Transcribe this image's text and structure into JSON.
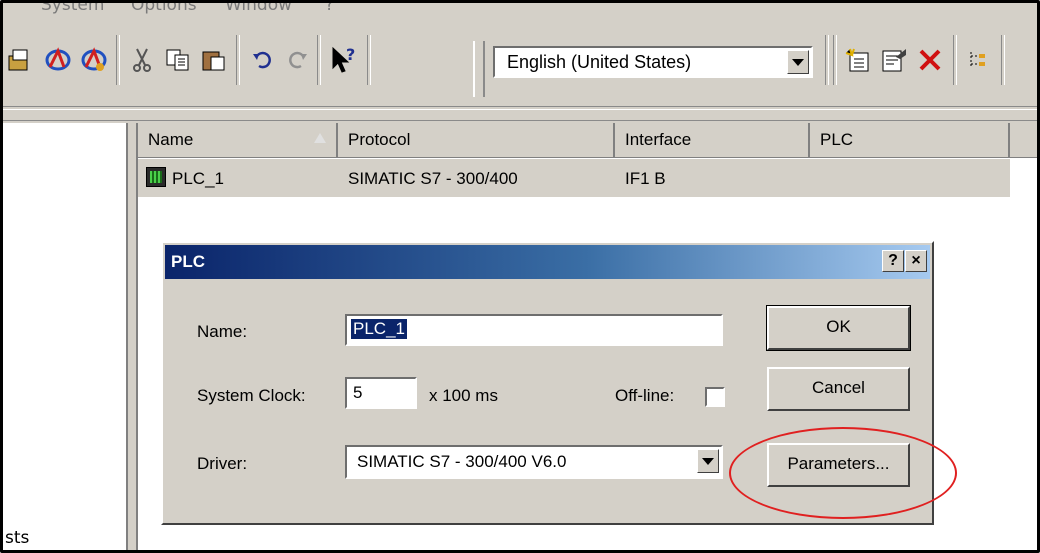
{
  "menu": {
    "items": [
      "System",
      "Options",
      "Window",
      "?"
    ]
  },
  "toolbar": {
    "icons": [
      "open-icon",
      "network-icon",
      "network-connect-icon",
      "cut-icon",
      "copy-icon",
      "paste-icon",
      "undo-icon",
      "redo-icon",
      "help-cursor-icon",
      "new-icon",
      "properties-icon",
      "delete-icon",
      "tree-icon"
    ],
    "language": "English (United States)"
  },
  "left_pane": {
    "item": "sts"
  },
  "list": {
    "columns": [
      "Name",
      "Protocol",
      "Interface",
      "PLC"
    ],
    "rows": [
      {
        "name": "PLC_1",
        "protocol": "SIMATIC S7 - 300/400",
        "interface": "IF1 B",
        "plc": ""
      }
    ]
  },
  "dialog": {
    "title": "PLC",
    "help_label": "?",
    "close_label": "×",
    "name_label": "Name:",
    "name_value": "PLC_1",
    "clock_label": "System Clock:",
    "clock_value": "5",
    "clock_unit": "x 100 ms",
    "offline_label": "Off-line:",
    "offline_checked": false,
    "driver_label": "Driver:",
    "driver_value": "SIMATIC S7 - 300/400  V6.0",
    "ok": "OK",
    "cancel": "Cancel",
    "parameters": "Parameters..."
  },
  "colors": {
    "titlebar_start": "#0a246a",
    "titlebar_end": "#a6caf0",
    "highlight_ellipse": "#e02020",
    "face": "#d4d0c8"
  }
}
